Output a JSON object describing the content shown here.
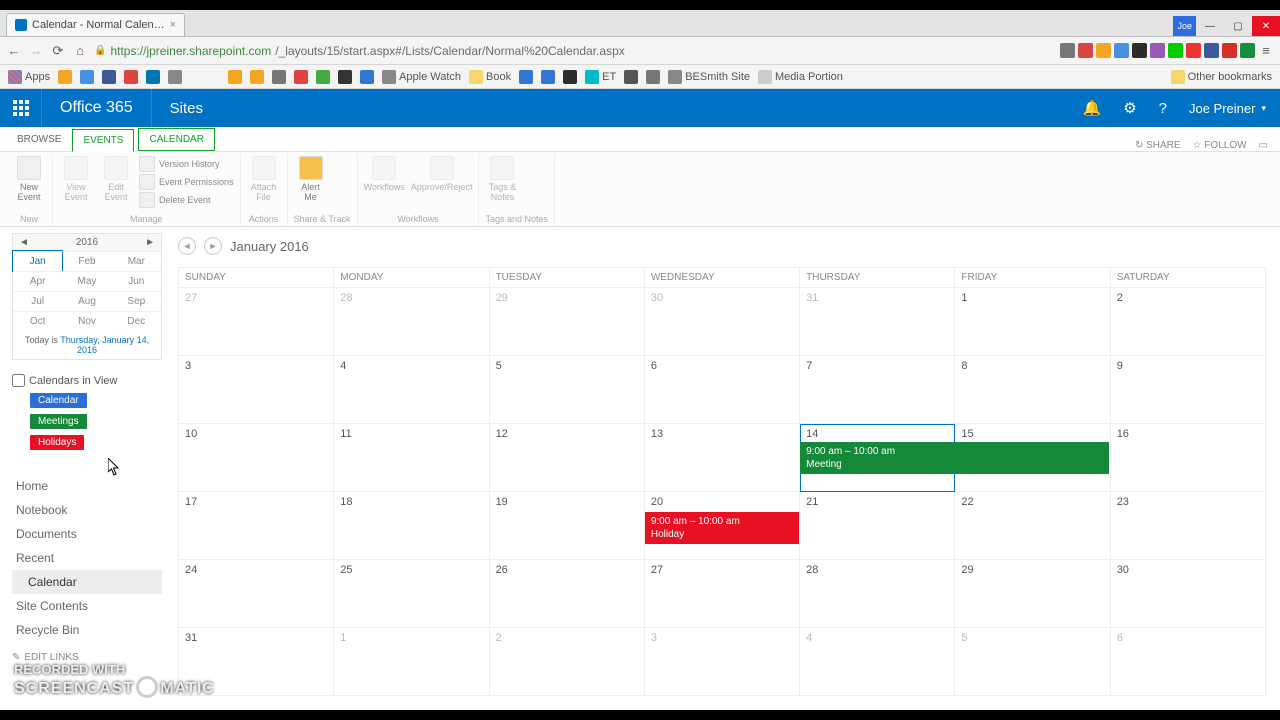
{
  "browser": {
    "tab_title": "Calendar - Normal Calen…",
    "url_host": "https://jpreiner.sharepoint.com",
    "url_path": "/_layouts/15/start.aspx#/Lists/Calendar/Normal%20Calendar.aspx",
    "win_user": "Joe"
  },
  "bookmarks": {
    "apps": "Apps",
    "apple_watch": "Apple Watch",
    "book": "Book",
    "et": "ET",
    "besmith": "BESmith Site",
    "media": "Media Portion",
    "other": "Other bookmarks"
  },
  "o365": {
    "brand": "Office 365",
    "area": "Sites",
    "user": "Joe Preiner"
  },
  "ribbon": {
    "tabs": {
      "browse": "BROWSE",
      "events": "EVENTS",
      "calendar": "CALENDAR"
    },
    "share_actions": {
      "share": "SHARE",
      "follow": "FOLLOW"
    },
    "new_event": "New\nEvent",
    "view_event": "View\nEvent",
    "edit_event": "Edit\nEvent",
    "version_history": "Version History",
    "event_permissions": "Event Permissions",
    "delete_event": "Delete Event",
    "attach_file": "Attach\nFile",
    "alert_me": "Alert\nMe",
    "workflows": "Workflows",
    "approve_reject": "Approve/Reject",
    "tags_notes": "Tags &\nNotes",
    "groups": {
      "new": "New",
      "manage": "Manage",
      "actions": "Actions",
      "share_track": "Share & Track",
      "workflows": "Workflows",
      "tags": "Tags and Notes"
    }
  },
  "mini": {
    "year": "2016",
    "months": [
      "Jan",
      "Feb",
      "Mar",
      "Apr",
      "May",
      "Jun",
      "Jul",
      "Aug",
      "Sep",
      "Oct",
      "Nov",
      "Dec"
    ],
    "today_prefix": "Today is ",
    "today_value": "Thursday, January 14, 2016"
  },
  "calendars_in_view": {
    "label": "Calendars in View",
    "items": [
      {
        "label": "Calendar",
        "color": "#2a6fd6"
      },
      {
        "label": "Meetings",
        "color": "#14893a"
      },
      {
        "label": "Holidays",
        "color": "#e81123"
      }
    ]
  },
  "nav": {
    "items": [
      "Home",
      "Notebook",
      "Documents",
      "Recent",
      "Calendar",
      "Site Contents",
      "Recycle Bin"
    ],
    "edit_links": "EDIT LINKS"
  },
  "calendar": {
    "title": "January 2016",
    "days": [
      "SUNDAY",
      "MONDAY",
      "TUESDAY",
      "WEDNESDAY",
      "THURSDAY",
      "FRIDAY",
      "SATURDAY"
    ],
    "weeks": [
      [
        {
          "n": "27",
          "o": true
        },
        {
          "n": "28",
          "o": true
        },
        {
          "n": "29",
          "o": true
        },
        {
          "n": "30",
          "o": true
        },
        {
          "n": "31",
          "o": true
        },
        {
          "n": "1"
        },
        {
          "n": "2"
        }
      ],
      [
        {
          "n": "3"
        },
        {
          "n": "4"
        },
        {
          "n": "5"
        },
        {
          "n": "6"
        },
        {
          "n": "7"
        },
        {
          "n": "8"
        },
        {
          "n": "9"
        }
      ],
      [
        {
          "n": "10"
        },
        {
          "n": "11"
        },
        {
          "n": "12"
        },
        {
          "n": "13"
        },
        {
          "n": "14",
          "today": true,
          "evt": {
            "time": "9:00 am – 10:00 am",
            "title": "Meeting",
            "cls": "green",
            "wide": true
          }
        },
        {
          "n": "15"
        },
        {
          "n": "16"
        }
      ],
      [
        {
          "n": "17"
        },
        {
          "n": "18"
        },
        {
          "n": "19"
        },
        {
          "n": "20",
          "evt": {
            "time": "9:00 am – 10:00 am",
            "title": "Holiday",
            "cls": "red"
          }
        },
        {
          "n": "21"
        },
        {
          "n": "22"
        },
        {
          "n": "23"
        }
      ],
      [
        {
          "n": "24"
        },
        {
          "n": "25"
        },
        {
          "n": "26"
        },
        {
          "n": "27"
        },
        {
          "n": "28"
        },
        {
          "n": "29"
        },
        {
          "n": "30"
        }
      ],
      [
        {
          "n": "31"
        },
        {
          "n": "1",
          "o": true
        },
        {
          "n": "2",
          "o": true
        },
        {
          "n": "3",
          "o": true
        },
        {
          "n": "4",
          "o": true
        },
        {
          "n": "5",
          "o": true
        },
        {
          "n": "6",
          "o": true
        }
      ]
    ]
  },
  "watermark": {
    "l1": "RECORDED WITH",
    "l2a": "SCREENCAST",
    "l2b": "MATIC"
  }
}
